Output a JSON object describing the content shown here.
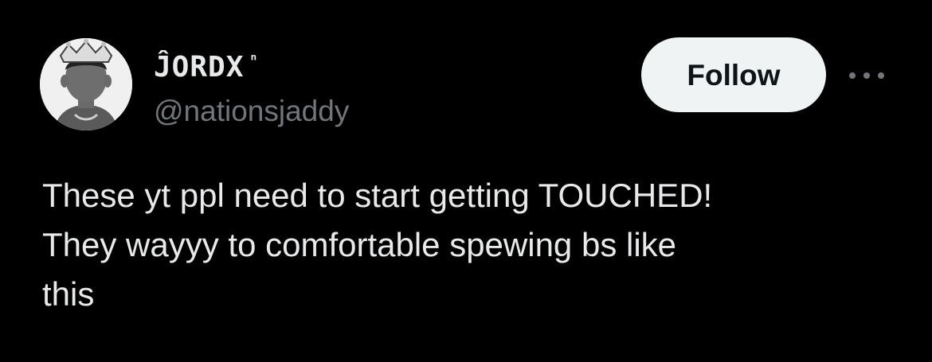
{
  "tweet": {
    "author": {
      "display_name": "ĴORDX",
      "display_name_suffix": "ⁿ",
      "handle": "@nationsjaddy",
      "avatar_icon": "avatar-crown-silhouette"
    },
    "follow_label": "Follow",
    "more_icon": "more-dots-icon",
    "text_lines": [
      "These yt ppl need to start getting TOUCHED!",
      "They wayyy to comfortable spewing bs like",
      "this"
    ]
  },
  "colors": {
    "background": "#000000",
    "primary_text": "#e7e9ea",
    "secondary_text": "#71767b",
    "follow_bg": "#eff3f4",
    "follow_text": "#0f1419"
  }
}
